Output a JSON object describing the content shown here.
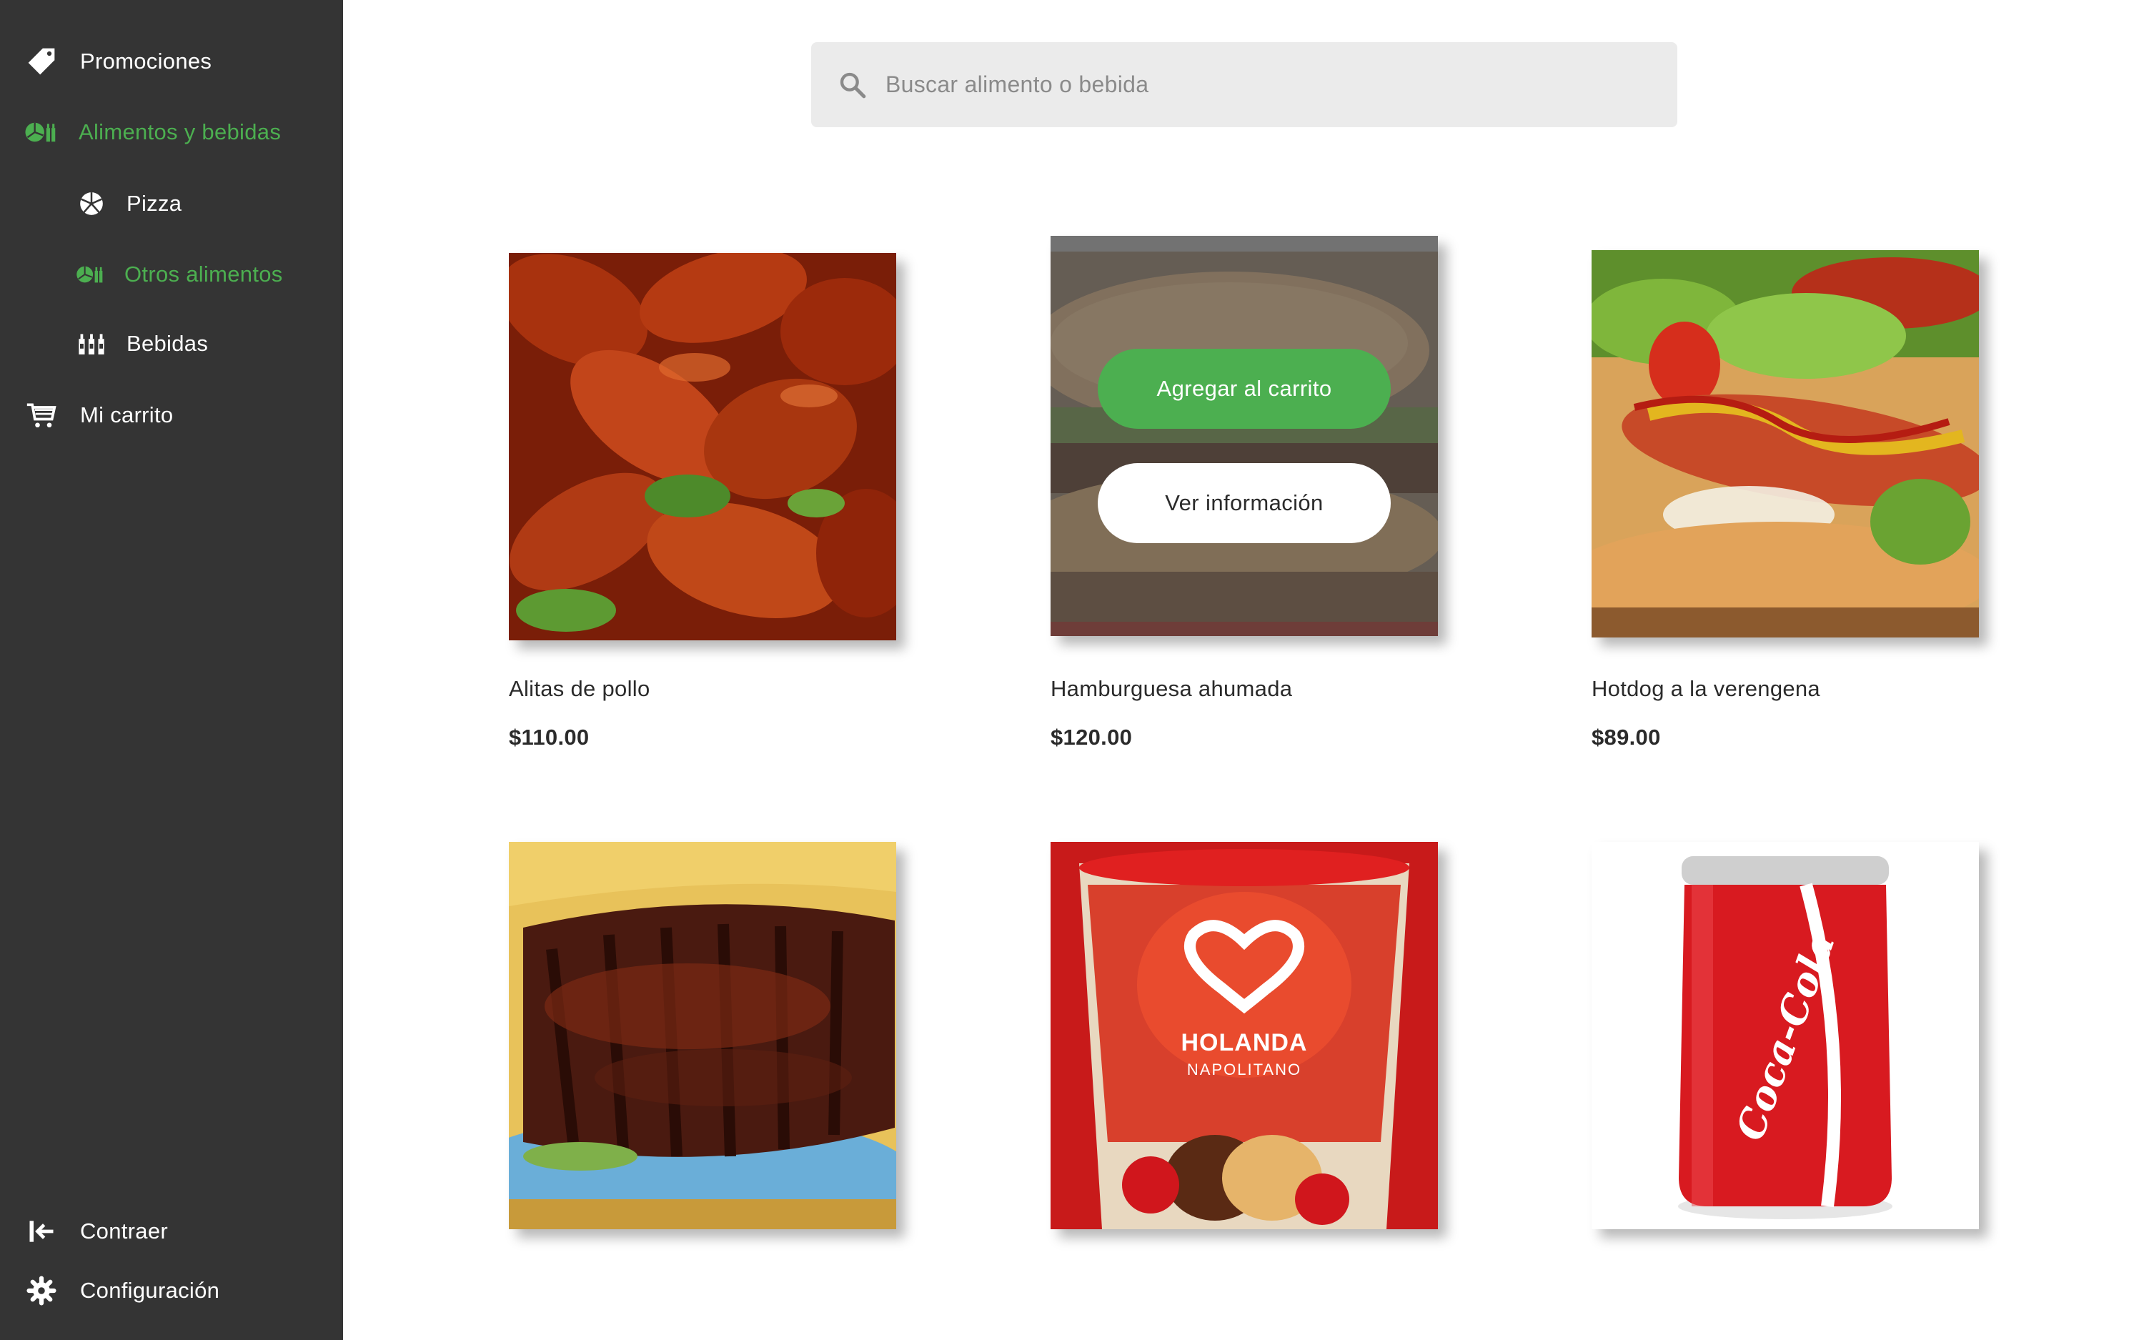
{
  "sidebar": {
    "items": [
      {
        "label": "Promociones",
        "icon": "tag-icon"
      },
      {
        "label": "Alimentos y bebidas",
        "icon": "food-drink-icon"
      },
      {
        "label": "Pizza",
        "icon": "pizza-icon"
      },
      {
        "label": "Otros alimentos",
        "icon": "food-drink-icon"
      },
      {
        "label": "Bebidas",
        "icon": "bottles-icon"
      },
      {
        "label": "Mi carrito",
        "icon": "cart-icon"
      }
    ],
    "footer": [
      {
        "label": "Contraer",
        "icon": "collapse-icon"
      },
      {
        "label": "Configuración",
        "icon": "gear-icon"
      }
    ],
    "active_color": "#4caf50",
    "background": "#343434"
  },
  "search": {
    "placeholder": "Buscar alimento o bebida",
    "value": ""
  },
  "products": [
    {
      "name": "Alitas de pollo",
      "price": "$110.00"
    },
    {
      "name": "Hamburguesa ahumada",
      "price": "$120.00",
      "actions": {
        "add": "Agregar al carrito",
        "info": "Ver información"
      }
    },
    {
      "name": "Hotdog a la verengena",
      "price": "$89.00"
    },
    {
      "name": "",
      "price": ""
    },
    {
      "name": "",
      "price": "",
      "image_text": {
        "brand": "HOLANDA",
        "flavor": "NAPOLITANO"
      }
    },
    {
      "name": "",
      "price": "",
      "image_text": {
        "brand": "Coca-Cola"
      }
    }
  ]
}
